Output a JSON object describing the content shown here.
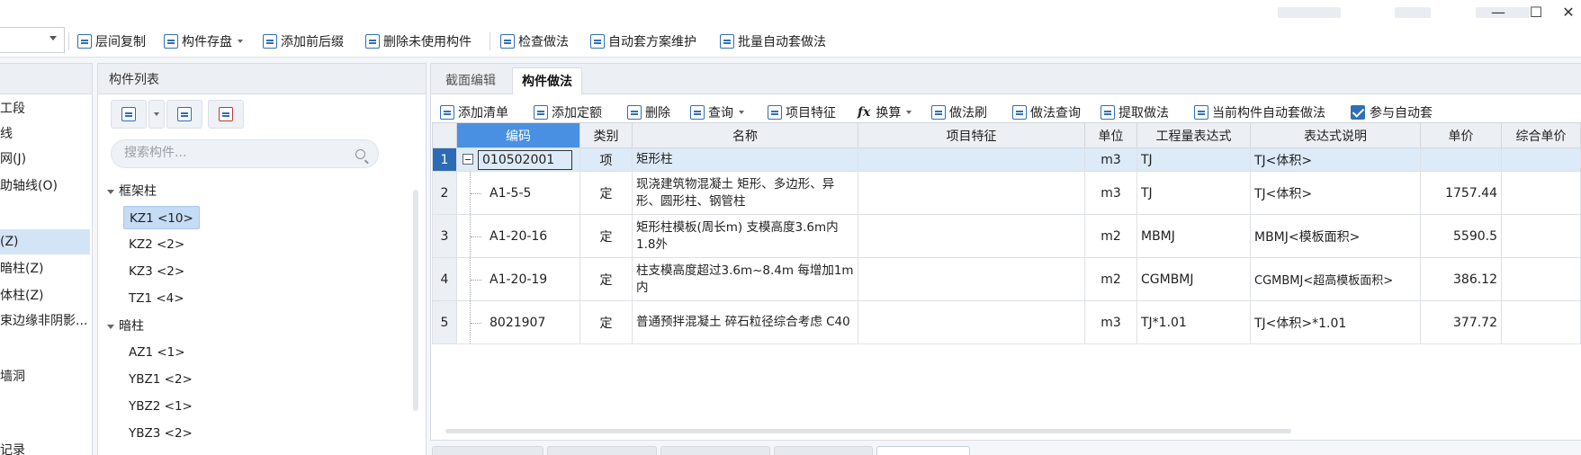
{
  "toolbar": {
    "buttons": [
      {
        "label": "层间复制",
        "icon": "copy-floor-icon"
      },
      {
        "label": "构件存盘",
        "icon": "save-component-icon"
      },
      {
        "label": "添加前后缀",
        "icon": "add-prefix-icon"
      },
      {
        "label": "删除未使用构件",
        "icon": "delete-unused-icon"
      },
      {
        "label": "检查做法",
        "icon": "check-method-icon"
      },
      {
        "label": "自动套方案维护",
        "icon": "auto-scheme-icon"
      },
      {
        "label": "批量自动套做法",
        "icon": "batch-auto-icon"
      }
    ]
  },
  "nav": {
    "items": [
      "工段",
      "线",
      "网(J)",
      "助轴线(O)",
      "(Z)",
      "暗柱(Z)",
      "体柱(Z)",
      "束边缘非阴影...",
      "墙洞",
      "记录"
    ]
  },
  "component_list": {
    "title": "构件列表",
    "search_placeholder": "搜索构件...",
    "groups": [
      {
        "name": "框架柱",
        "items": [
          "KZ1 <10>",
          "KZ2 <2>",
          "KZ3 <2>",
          "TZ1 <4>"
        ]
      },
      {
        "name": "暗柱",
        "items": [
          "AZ1 <1>",
          "YBZ1 <2>",
          "YBZ2 <1>",
          "YBZ3 <2>"
        ]
      }
    ]
  },
  "method_panel": {
    "tabs": [
      "截面编辑",
      "构件做法"
    ],
    "toolbar": [
      {
        "label": "添加清单",
        "icon": "add-list-icon"
      },
      {
        "label": "添加定额",
        "icon": "add-quota-icon"
      },
      {
        "label": "删除",
        "icon": "delete-icon"
      },
      {
        "label": "查询",
        "icon": "query-icon"
      },
      {
        "label": "项目特征",
        "icon": "feature-icon"
      },
      {
        "label": "换算",
        "icon": "fx-icon"
      },
      {
        "label": "做法刷",
        "icon": "brush-icon"
      },
      {
        "label": "做法查询",
        "icon": "method-query-icon"
      },
      {
        "label": "提取做法",
        "icon": "extract-icon"
      },
      {
        "label": "当前构件自动套做法",
        "icon": "current-auto-icon"
      }
    ],
    "auto_checkbox_label": "参与自动套",
    "columns": [
      "编码",
      "类别",
      "名称",
      "项目特征",
      "单位",
      "工程量表达式",
      "表达式说明",
      "单价",
      "综合单价"
    ],
    "rows": [
      {
        "num": "1",
        "code": "010502001",
        "type": "项",
        "name": "矩形柱",
        "feature": "",
        "unit": "m3",
        "expr": "TJ",
        "desc": "TJ<体积>",
        "price": "",
        "total": ""
      },
      {
        "num": "2",
        "code": "A1-5-5",
        "type": "定",
        "name": "现浇建筑物混凝土 矩形、多边形、异形、圆形柱、钢管柱",
        "feature": "",
        "unit": "m3",
        "expr": "TJ",
        "desc": "TJ<体积>",
        "price": "1757.44",
        "total": ""
      },
      {
        "num": "3",
        "code": "A1-20-16",
        "type": "定",
        "name": "矩形柱模板(周长m) 支模高度3.6m内 1.8外",
        "feature": "",
        "unit": "m2",
        "expr": "MBMJ",
        "desc": "MBMJ<模板面积>",
        "price": "5590.5",
        "total": ""
      },
      {
        "num": "4",
        "code": "A1-20-19",
        "type": "定",
        "name": "柱支模高度超过3.6m~8.4m 每增加1m内",
        "feature": "",
        "unit": "m2",
        "expr": "CGMBMJ",
        "desc": "CGMBMJ<超高模板面积>",
        "price": "386.12",
        "total": ""
      },
      {
        "num": "5",
        "code": "8021907",
        "type": "定",
        "name": "普通预拌混凝土 碎石粒径综合考虑 C40",
        "feature": "",
        "unit": "m3",
        "expr": "TJ*1.01",
        "desc": "TJ<体积>*1.01",
        "price": "377.72",
        "total": ""
      }
    ]
  }
}
